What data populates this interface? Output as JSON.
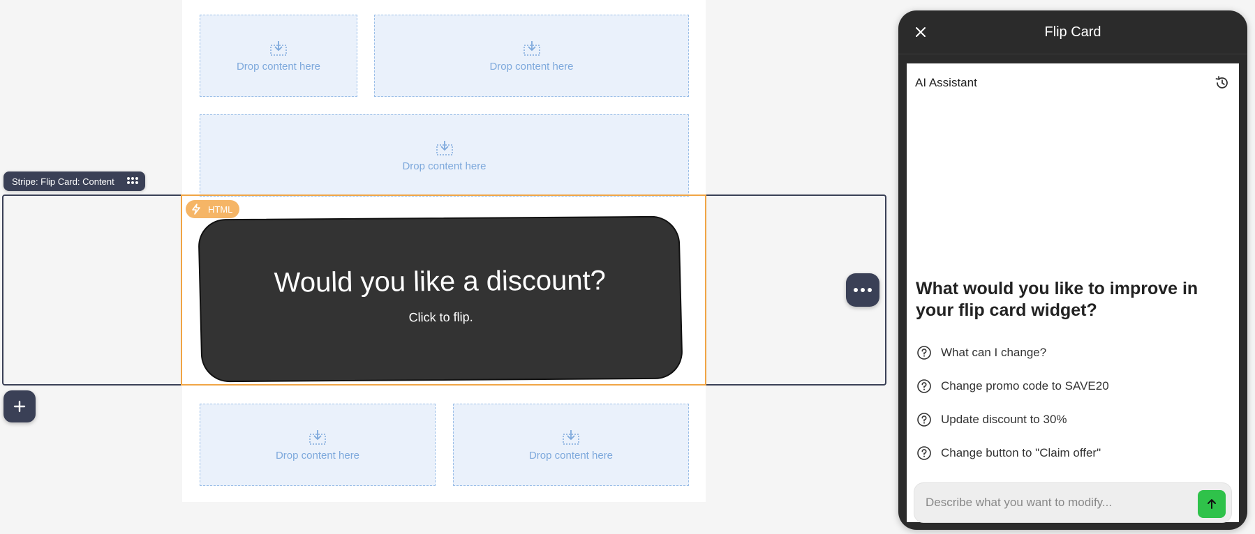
{
  "canvas": {
    "dropzone_label": "Drop content here"
  },
  "stripe": {
    "badge_label": "Stripe: Flip Card: Content"
  },
  "html_block": {
    "badge_label": "HTML"
  },
  "flip_card": {
    "title": "Would you like a discount?",
    "subtitle": "Click to flip."
  },
  "panel": {
    "title": "Flip Card",
    "assistant_label": "AI Assistant",
    "prompt_title": "What would you like to improve in your flip card widget?",
    "suggestions": [
      "What can I change?",
      "Change promo code to SAVE20",
      "Update discount to 30%",
      "Change button to \"Claim offer\""
    ],
    "input_placeholder": "Describe what you want to modify..."
  },
  "icons": {
    "dropzone": "download-dropzone-icon",
    "html_badge": "lightning-icon",
    "more": "more-horizontal-icon",
    "add": "plus-icon",
    "close": "close-icon",
    "history": "history-icon",
    "suggestion": "question-circle-icon",
    "send": "arrow-up-icon",
    "drag": "drag-grid-icon"
  },
  "colors": {
    "canvas_bg": "#f5f5f5",
    "dropzone_bg": "#eaf1fb",
    "dropzone_text": "#7ea9dc",
    "stripe_accent": "#3a4056",
    "html_accent": "#f0a545",
    "card_bg": "#333333",
    "panel_bg": "#2b2b2b",
    "send_button": "#2fc24a"
  }
}
